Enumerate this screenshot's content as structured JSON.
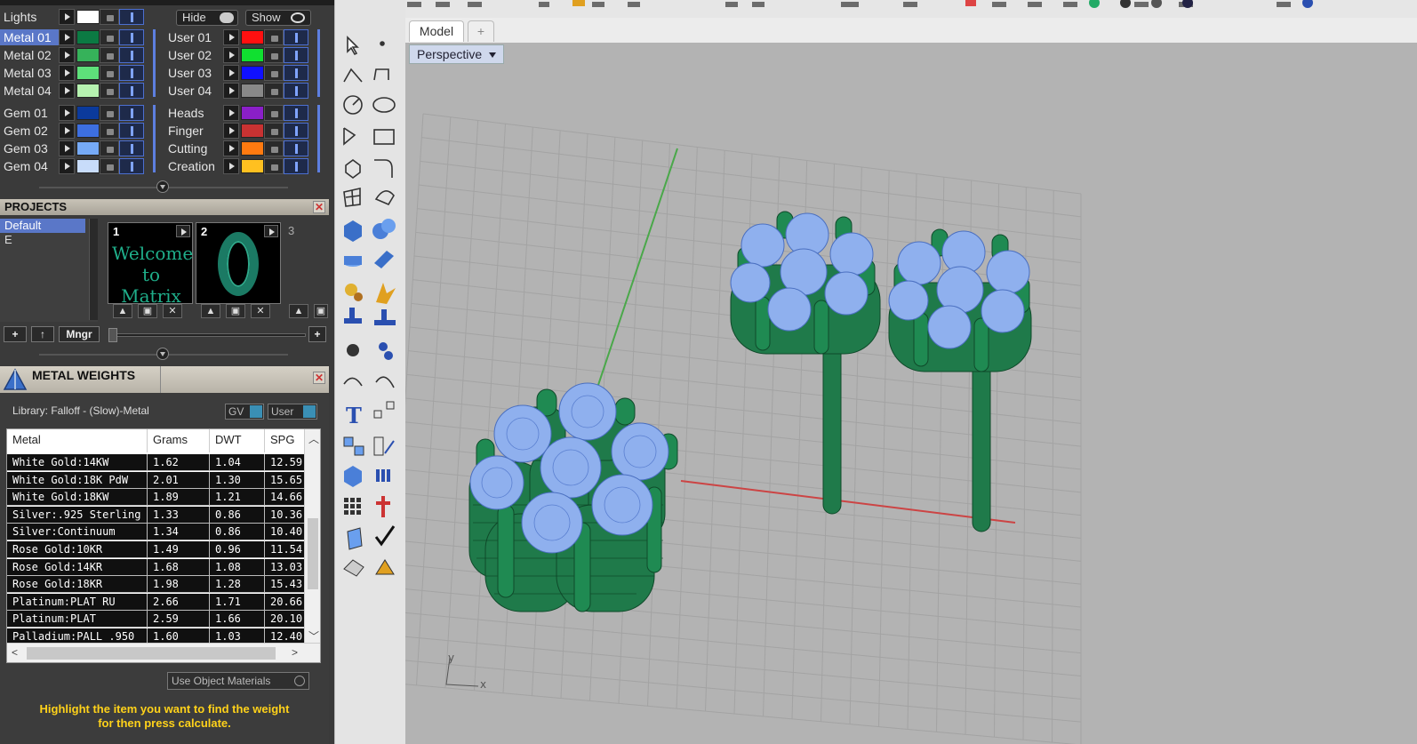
{
  "layers": {
    "lights": {
      "label": "Lights",
      "hide_label": "Hide",
      "show_label": "Show",
      "color": "#ffffff"
    },
    "left_column": [
      {
        "label": "Metal 01",
        "color": "#0b7a43",
        "selected": true
      },
      {
        "label": "Metal 02",
        "color": "#36b25a",
        "selected": false
      },
      {
        "label": "Metal 03",
        "color": "#5ee07a",
        "selected": false
      },
      {
        "label": "Metal 04",
        "color": "#b6f2b0",
        "selected": false
      },
      {
        "label": "Gem 01",
        "color": "#0b3a9c",
        "selected": false
      },
      {
        "label": "Gem 02",
        "color": "#3d6fe0",
        "selected": false
      },
      {
        "label": "Gem 03",
        "color": "#76aaf6",
        "selected": false
      },
      {
        "label": "Gem 04",
        "color": "#c8dcfa",
        "selected": false
      }
    ],
    "right_column": [
      {
        "label": "User 01",
        "color": "#ff1010"
      },
      {
        "label": "User 02",
        "color": "#10e030"
      },
      {
        "label": "User 03",
        "color": "#1010ff"
      },
      {
        "label": "User 04",
        "color": "#888888"
      },
      {
        "label": "Heads",
        "color": "#8a1fc8"
      },
      {
        "label": "Finger",
        "color": "#c83232"
      },
      {
        "label": "Cutting",
        "color": "#ff7a10"
      },
      {
        "label": "Creation",
        "color": "#ffc020"
      }
    ]
  },
  "projects": {
    "title": "PROJECTS",
    "list": [
      "Default",
      "E"
    ],
    "thumbs": [
      {
        "num": "1",
        "caption": "Welcome to Matrix"
      },
      {
        "num": "2",
        "caption": ""
      },
      {
        "num": "3",
        "caption": ""
      }
    ],
    "mngr_label": "Mngr"
  },
  "metal_weights": {
    "title": "METAL WEIGHTS",
    "library": "Library: Falloff - (Slow)-Metal",
    "gv_label": "GV",
    "user_label": "User",
    "columns": [
      "Metal",
      "Grams",
      "DWT",
      "SPG"
    ],
    "rows": [
      [
        "White Gold:14KW",
        "1.62",
        "1.04",
        "12.59"
      ],
      [
        "White Gold:18K PdW",
        "2.01",
        "1.30",
        "15.65"
      ],
      [
        "White Gold:18KW",
        "1.89",
        "1.21",
        "14.66"
      ],
      [
        "Silver:.925 Sterling",
        "1.33",
        "0.86",
        "10.36"
      ],
      [
        "Silver:Continuum",
        "1.34",
        "0.86",
        "10.40"
      ],
      [
        "Rose Gold:10KR",
        "1.49",
        "0.96",
        "11.54"
      ],
      [
        "Rose Gold:14KR",
        "1.68",
        "1.08",
        "13.03"
      ],
      [
        "Rose Gold:18KR",
        "1.98",
        "1.28",
        "15.43"
      ],
      [
        "Platinum:PLAT RU",
        "2.66",
        "1.71",
        "20.66"
      ],
      [
        "Platinum:PLAT",
        "2.59",
        "1.66",
        "20.10"
      ],
      [
        "Palladium:PALL .950",
        "1.60",
        "1.03",
        "12.40"
      ]
    ],
    "use_object_materials": "Use Object Materials",
    "hint_line1": "Highlight the item you want to find the weight",
    "hint_line2": "for then press calculate."
  },
  "viewport": {
    "tab_model": "Model",
    "tab_add": "+",
    "view_name": "Perspective",
    "axis_x": "x",
    "axis_y": "y",
    "colors": {
      "grid_bg": "#b3b3b3",
      "metal": "#1f7a4a",
      "gem": "#8fb0ee",
      "x_axis": "#c44",
      "y_axis": "#4a4"
    }
  }
}
